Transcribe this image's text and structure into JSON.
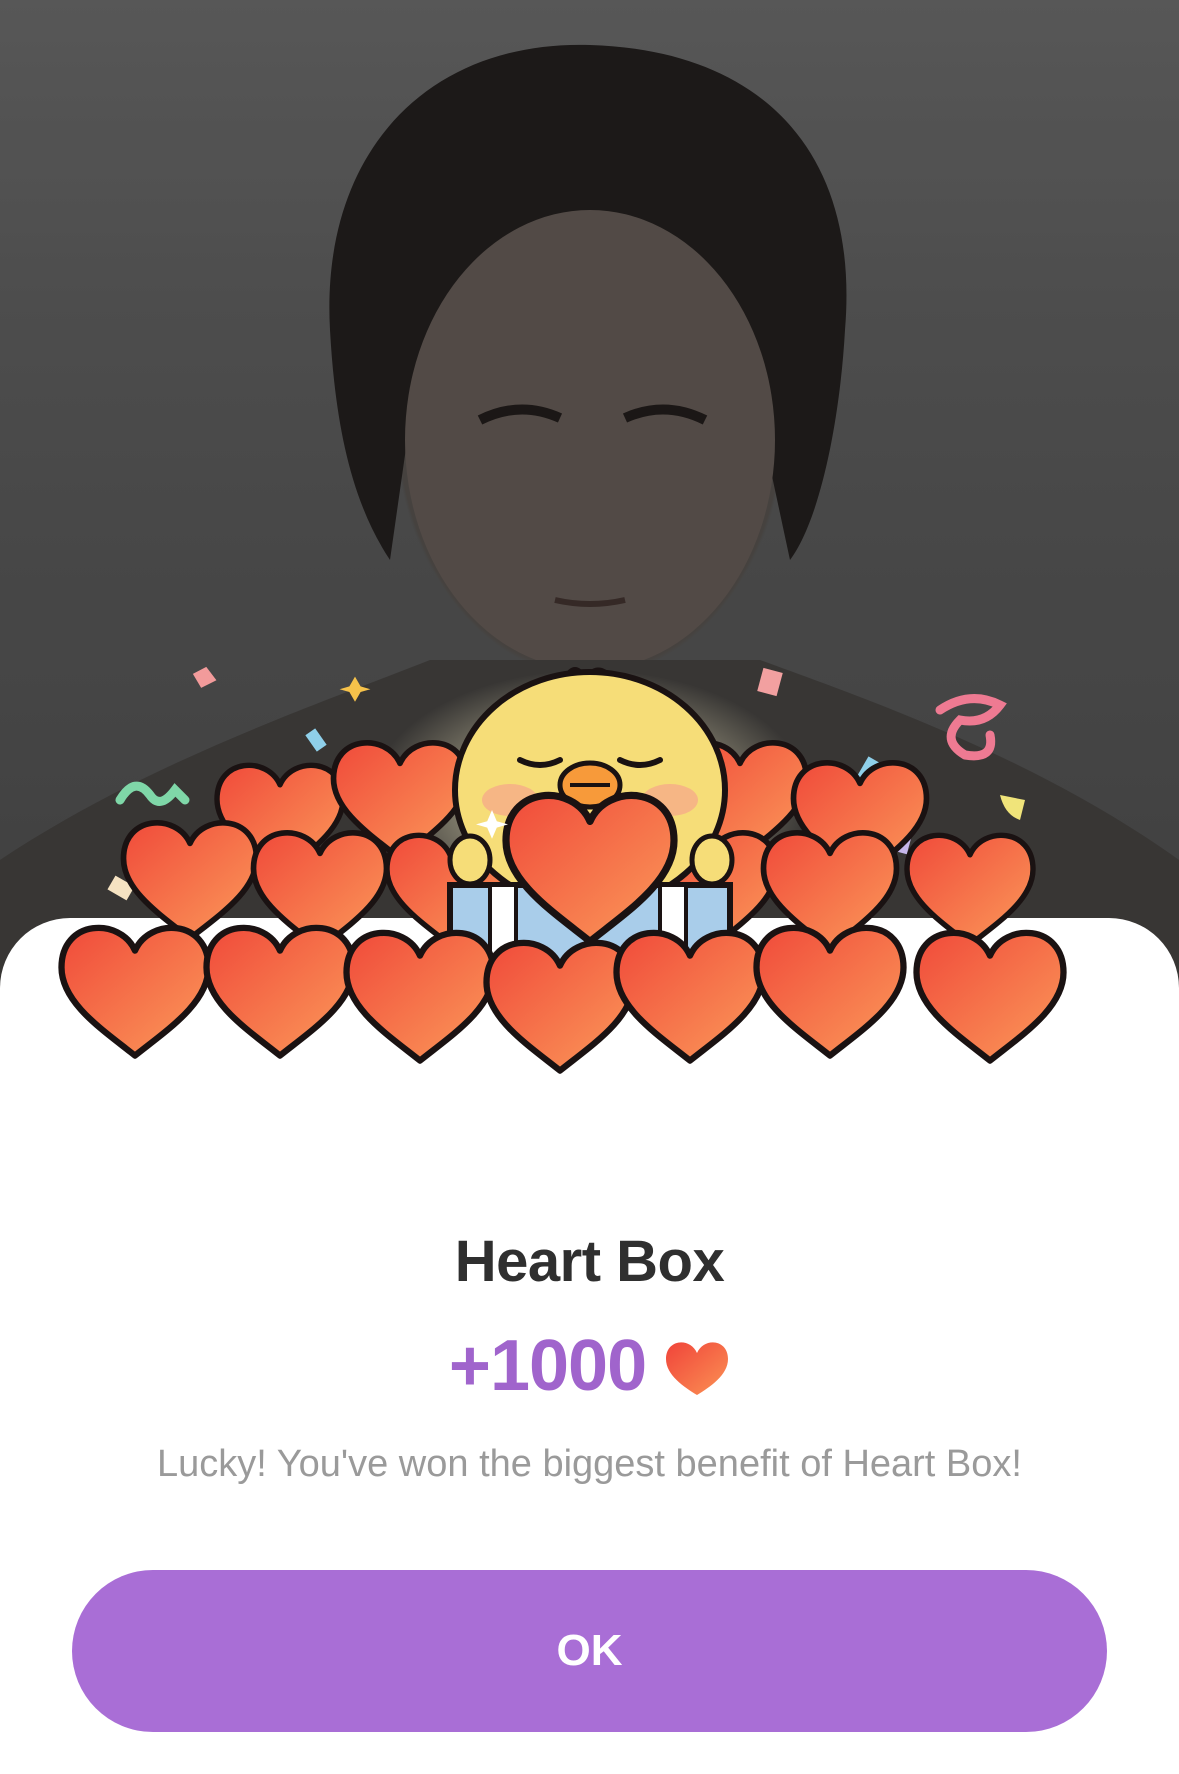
{
  "dialog": {
    "title": "Heart Box",
    "reward_amount": "+1000",
    "reward_icon": "heart-icon",
    "message": "Lucky! You've won the biggest benefit of Heart Box!",
    "ok_label": "OK"
  },
  "colors": {
    "accent": "#a96ed6",
    "reward_text": "#a064cc",
    "heart": "#f2553a",
    "title_text": "#2f2f2f",
    "message_text": "#9a9a9a"
  },
  "illustration": {
    "name": "chick-with-heart-pile",
    "icons": [
      "chick-mascot",
      "heart-pile",
      "gift-box",
      "confetti"
    ]
  }
}
